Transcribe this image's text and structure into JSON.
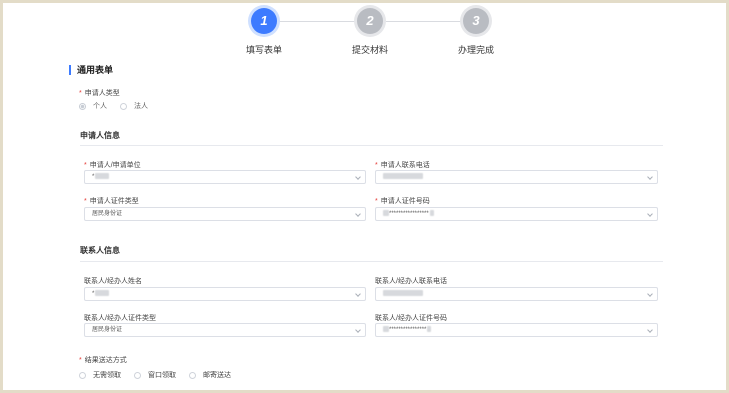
{
  "steps": [
    {
      "number": "1",
      "label": "填写表单",
      "state": "active"
    },
    {
      "number": "2",
      "label": "提交材料",
      "state": "inactive"
    },
    {
      "number": "3",
      "label": "办理完成",
      "state": "inactive"
    }
  ],
  "form": {
    "title": "通用表单",
    "applicant_type": {
      "label": "申请人类型",
      "options": [
        "个人",
        "法人"
      ],
      "selected": "个人"
    },
    "applicant_info": {
      "title": "申请人信息",
      "name_label": "申请人/申请单位",
      "name_value": "*",
      "phone_label": "申请人联系电话",
      "phone_value": "",
      "id_type_label": "申请人证件类型",
      "id_type_value": "居民身份证",
      "id_no_label": "申请人证件号码",
      "id_no_value": "*****************"
    },
    "contact_info": {
      "title": "联系人信息",
      "name_label": "联系人/经办人姓名",
      "name_value": "*",
      "phone_label": "联系人/经办人联系电话",
      "phone_value": "",
      "id_type_label": "联系人/经办人证件类型",
      "id_type_value": "居民身份证",
      "id_no_label": "联系人/经办人证件号码",
      "id_no_value": "****************"
    },
    "delivery": {
      "label": "结果送达方式",
      "options": [
        "无需领取",
        "窗口领取",
        "邮寄送达"
      ]
    }
  },
  "colors": {
    "accent": "#3d7bff",
    "required": "#e53935",
    "inactive_step": "#b9bcc2"
  }
}
